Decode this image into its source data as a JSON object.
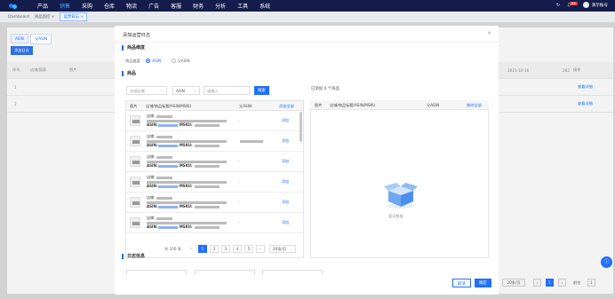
{
  "topnav": {
    "items": [
      "产品",
      "销售",
      "采购",
      "仓库",
      "物流",
      "广告",
      "客服",
      "财务",
      "分析",
      "工具",
      "系统"
    ],
    "active_index": 1,
    "badge": "84",
    "user_name": "演示账号"
  },
  "tabs": [
    {
      "label": "Dashboard"
    },
    {
      "label": "商品监控 ×"
    },
    {
      "label": "运营日志 ×"
    }
  ],
  "background": {
    "filter_buttons": [
      "ASIN",
      "父ASIN"
    ],
    "add_log_button": "添加日志",
    "table_headers": [
      "序号",
      "店铺/国家",
      "图片",
      "",
      "2021-10-16",
      "202",
      "操作"
    ],
    "rows": [
      {
        "index": "1",
        "action": "查看详细"
      },
      {
        "index": "2",
        "action": "查看详细"
      }
    ],
    "per_page": "20条/页",
    "goto_label": "前往"
  },
  "modal": {
    "title": "添加运营日志",
    "close_icon": "close-icon",
    "section_dimension": "商品维度",
    "dimension_label": "商品维度",
    "dimension_options": [
      "ASIN",
      "父ASIN"
    ],
    "dimension_selected": 0,
    "section_goods": "商品",
    "filters": {
      "shop_placeholder": "全部店铺",
      "type_value": "ASIN",
      "search_placeholder": "请输入",
      "query_button": "搜索"
    },
    "left_table": {
      "headers": [
        "图片",
        "店铺/商品标题/ASIN/MSKU",
        "父ASIN",
        "添加全部"
      ],
      "rows": [
        {
          "shop": "店铺:",
          "asin": "ASIN:",
          "msku": "MSKU:",
          "parent": "-",
          "action": "添加"
        },
        {
          "shop": "店铺:",
          "asin": "ASIN:",
          "msku": "MSKU:",
          "parent": "",
          "action": "添加"
        },
        {
          "shop": "店铺:",
          "asin": "ASIN:",
          "msku": "MSKU:",
          "parent": "-",
          "action": "添加"
        },
        {
          "shop": "店铺:",
          "asin": "ASIN:",
          "msku": "MSKU:",
          "parent": "-",
          "action": "添加"
        },
        {
          "shop": "店铺:",
          "asin": "ASIN:",
          "msku": "MSKU:",
          "parent": "-",
          "action": "添加"
        },
        {
          "shop": "店铺:",
          "asin": "ASIN:",
          "msku": "MSKU:",
          "parent": "-",
          "action": "添加"
        }
      ]
    },
    "pagination": {
      "total": "共 100 条",
      "pages": [
        "1",
        "2",
        "3",
        "4",
        "5"
      ],
      "current": "1",
      "page_size": "20条/页",
      "prev": "‹",
      "next": "›"
    },
    "right_panel": {
      "title": "已添加 0 个商品",
      "headers": [
        "图片",
        "店铺/商品标题/ASIN/MSKU",
        "父ASIN",
        "移除全部"
      ],
      "empty_text": "暂无数据"
    },
    "section_log": "日志信息",
    "cancel_button": "取消",
    "confirm_button": "确定",
    "colors": {
      "primary": "#1f6fff",
      "nav_bg": "#131c4a"
    }
  }
}
